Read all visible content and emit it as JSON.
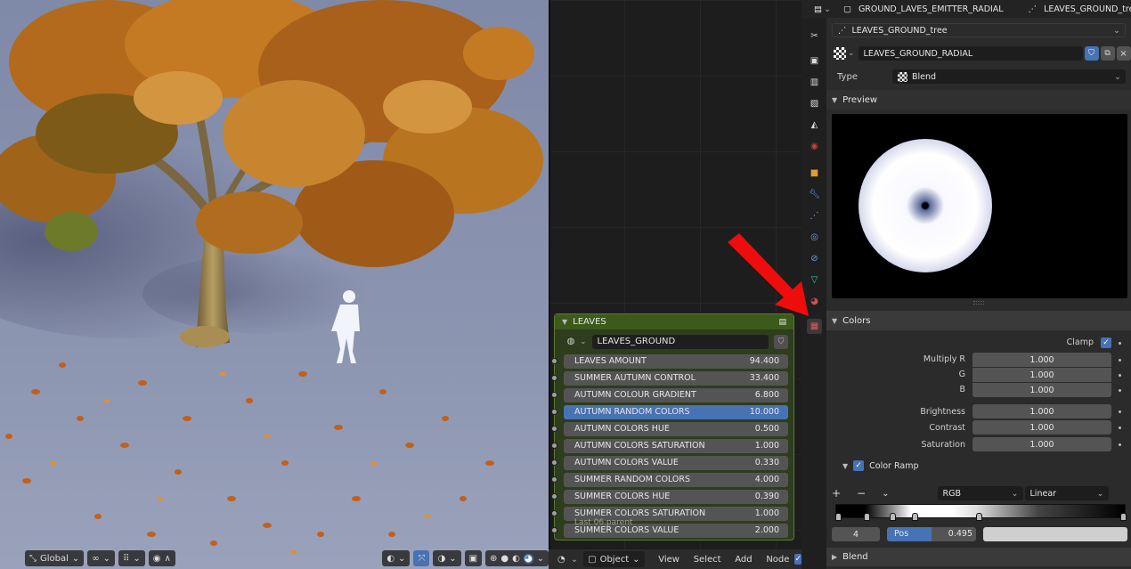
{
  "viewport": {
    "header": {
      "orientation": "Global"
    }
  },
  "node": {
    "title": "LEAVES",
    "group_name": "LEAVES_GROUND",
    "inputs": [
      {
        "label": "LEAVES AMOUNT",
        "value": "94.400"
      },
      {
        "label": "SUMMER AUTUMN CONTROL",
        "value": "33.400"
      },
      {
        "label": "AUTUMN COLOUR GRADIENT",
        "value": "6.800"
      },
      {
        "label": "AUTUMN RANDOM COLORS",
        "value": "10.000"
      },
      {
        "label": "AUTUMN COLORS HUE",
        "value": "0.500"
      },
      {
        "label": "AUTUMN COLORS SATURATION",
        "value": "1.000"
      },
      {
        "label": "AUTUMN COLORS VALUE",
        "value": "0.330"
      },
      {
        "label": "SUMMER RANDOM COLORS",
        "value": "4.000"
      },
      {
        "label": "SUMMER COLORS HUE",
        "value": "0.390"
      },
      {
        "label": "SUMMER COLORS  SATURATION",
        "value": "1.000"
      },
      {
        "label": "SUMMER COLORS VALUE",
        "value": "2.000"
      }
    ],
    "active_index": 3
  },
  "node_editor": {
    "bottom": {
      "mode": "Object",
      "menu_view": "View",
      "menu_select": "Select",
      "menu_add": "Add",
      "menu_node": "Node",
      "overlay_text": "Last 06.parent"
    }
  },
  "props": {
    "top": {
      "emitter": "GROUND_LAVES_EMITTER_RADIAL",
      "tree": "LEAVES_GROUND_tree"
    },
    "texture_tree": "LEAVES_GROUND_tree",
    "texture_name": "LEAVES_GROUND_RADIAL",
    "type_label": "Type",
    "type_value": "Blend",
    "preview_label": "Preview",
    "colors_label": "Colors",
    "clamp_label": "Clamp",
    "multiply": {
      "label": "Multiply R",
      "r": "1.000",
      "g_label": "G",
      "g": "1.000",
      "b_label": "B",
      "b": "1.000"
    },
    "brightness": {
      "label": "Brightness",
      "value": "1.000"
    },
    "contrast": {
      "label": "Contrast",
      "value": "1.000"
    },
    "saturation": {
      "label": "Saturation",
      "value": "1.000"
    },
    "color_ramp": {
      "label": "Color Ramp",
      "plus": "+",
      "minus": "−",
      "mode": "RGB",
      "interp": "Linear",
      "index": "4",
      "pos_label": "Pos",
      "pos_value": "0.495",
      "pos_fraction": 0.495
    },
    "blend_label": "Blend"
  }
}
